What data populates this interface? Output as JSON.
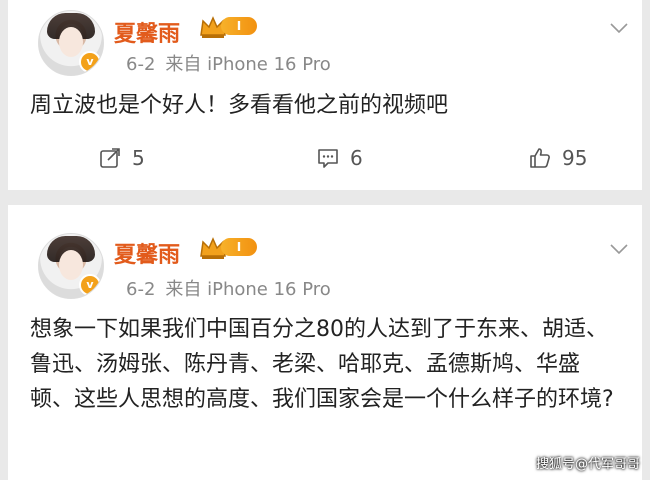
{
  "posts": [
    {
      "author": "夏馨雨",
      "level": "I",
      "date": "6-2",
      "source": "来自 iPhone 16 Pro",
      "content": "周立波也是个好人！多看看他之前的视频吧",
      "actions": {
        "share": "5",
        "comment": "6",
        "like": "95"
      }
    },
    {
      "author": "夏馨雨",
      "level": "I",
      "date": "6-2",
      "source": "来自 iPhone 16 Pro",
      "content": "想象一下如果我们中国百分之80的人达到了于东来、胡适、鲁迅、汤姆张、陈丹青、老梁、哈耶克、孟德斯鸠、华盛顿、这些人思想的高度、我们国家会是一个什么样子的环境?"
    }
  ],
  "watermark": "搜狐号@代军哥哥",
  "icons": {
    "share": "share-icon",
    "comment": "comment-icon",
    "like": "thumbs-up-icon",
    "more": "chevron-down-icon",
    "crown": "crown-icon",
    "verified": "verified-badge-icon"
  },
  "colors": {
    "author": "#e25b1c",
    "level_badge": "#f29110",
    "meta": "#888888",
    "background": "#e9e9e9"
  }
}
